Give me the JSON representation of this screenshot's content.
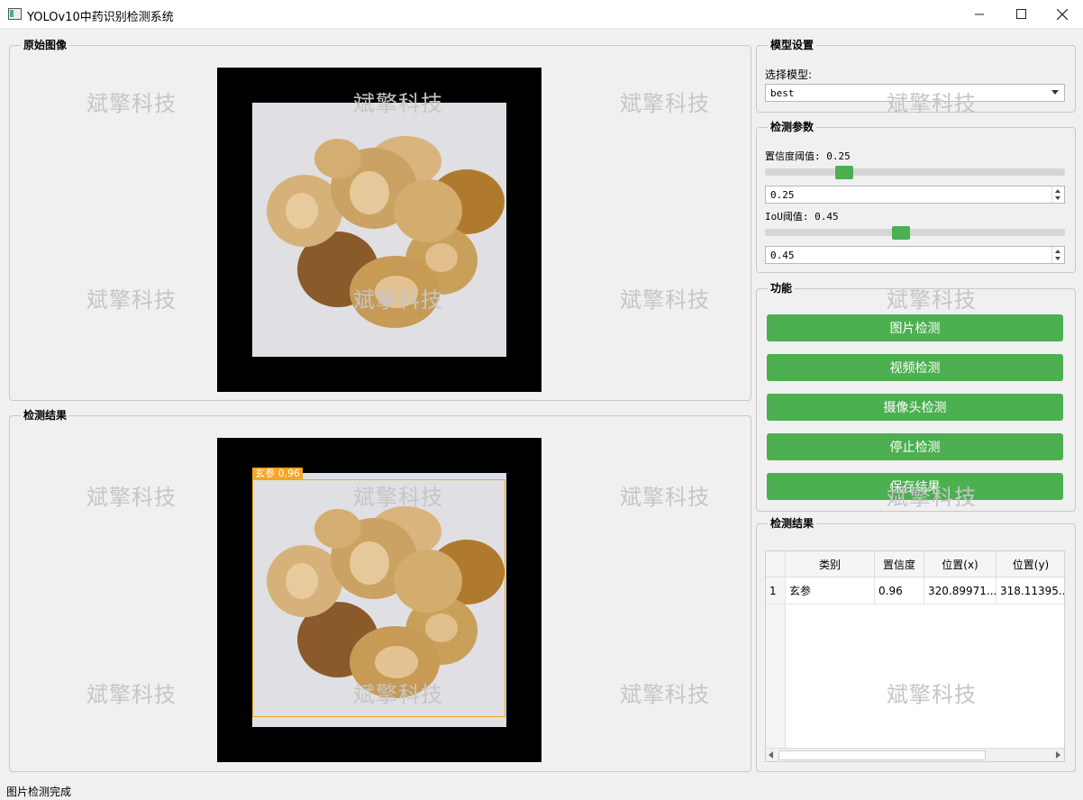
{
  "window": {
    "title": "YOLOv10中药识别检测系统",
    "minimize_icon": "minimize-icon",
    "maximize_icon": "maximize-icon",
    "close_icon": "close-icon"
  },
  "watermark": "斌擎科技",
  "original_panel": {
    "title": "原始图像"
  },
  "result_panel": {
    "title": "检测结果"
  },
  "detection_box": {
    "label": "玄参 0.96",
    "color": "#f5a623"
  },
  "model_settings": {
    "title": "模型设置",
    "select_label": "选择模型:",
    "selected_model": "best"
  },
  "detect_params": {
    "title": "检测参数",
    "confidence_label": "置信度阈值: 0.25",
    "confidence_value": "0.25",
    "confidence_slider_fraction": 0.25,
    "iou_label": "IoU阈值: 0.45",
    "iou_value": "0.45",
    "iou_slider_fraction": 0.45
  },
  "functions": {
    "title": "功能",
    "buttons": [
      "图片检测",
      "视频检测",
      "摄像头检测",
      "停止检测",
      "保存结果"
    ]
  },
  "results_table": {
    "title": "检测结果",
    "columns": [
      "类别",
      "置信度",
      "位置(x)",
      "位置(y)"
    ],
    "rows": [
      {
        "index": "1",
        "class": "玄参",
        "confidence": "0.96",
        "x": "320.89971...",
        "y": "318.11395..."
      }
    ]
  },
  "status": "图片检测完成",
  "colors": {
    "accent_green": "#4caf50",
    "box_orange": "#f5a623"
  }
}
